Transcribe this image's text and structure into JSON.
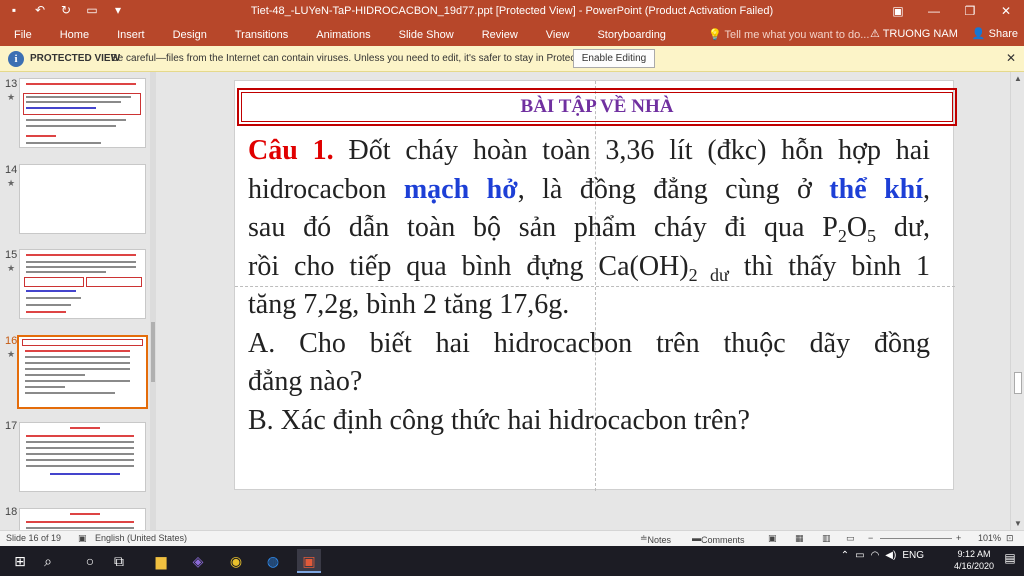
{
  "window": {
    "title": "Tiet-48_-LUYeN-TaP-HIDROCACBON_19d77.ppt [Protected View] - PowerPoint (Product Activation Failed)"
  },
  "ribbon": {
    "tabs": [
      "File",
      "Home",
      "Insert",
      "Design",
      "Transitions",
      "Animations",
      "Slide Show",
      "Review",
      "View",
      "Storyboarding"
    ],
    "tell_me": "Tell me what you want to do...",
    "user": "TRUONG NAM",
    "share": "Share"
  },
  "protected_view": {
    "label": "PROTECTED VIEW",
    "message": "Be careful—files from the Internet can contain viruses. Unless you need to edit, it's safer to stay in Protected View.",
    "button": "Enable Editing"
  },
  "thumbnails": [
    {
      "num": "13",
      "star": "★"
    },
    {
      "num": "14",
      "star": "★"
    },
    {
      "num": "15",
      "star": "★"
    },
    {
      "num": "16",
      "star": "★"
    },
    {
      "num": "17",
      "star": ""
    },
    {
      "num": "18",
      "star": ""
    }
  ],
  "slide": {
    "title": "BÀI TẬP VỀ NHÀ",
    "question_label": "Câu 1.",
    "line1": "Đốt cháy hoàn toàn 3,36 lít (đkc) hỗn hợp hai",
    "line2a": "hidrocacbon",
    "line2b": "mạch hở",
    "line2c": ", là đồng đẳng cùng ở",
    "line2d": "thể khí",
    "line2e": ",",
    "line3a": "sau đó dẫn toàn bộ sản phẩm cháy đi qua P",
    "line3b": "2",
    "line3c": "O",
    "line3d": "5",
    "line3e": " dư,",
    "line4a": "rồi cho tiếp qua bình đựng Ca(OH)",
    "line4b": "2 dư",
    "line4c": " thì thấy bình 1",
    "line5": "tăng 7,2g, bình 2 tăng 17,6g.",
    "line6": "A. Cho biết hai hidrocacbon trên thuộc dãy đồng",
    "line7": "đẳng nào?",
    "line8": "B. Xác định công thức hai hidrocacbon trên?"
  },
  "status": {
    "slide_of": "Slide 16 of 19",
    "language": "English (United States)",
    "notes": "Notes",
    "comments": "Comments",
    "zoom": "101%"
  },
  "taskbar": {
    "language": "ENG",
    "time": "9:12 AM",
    "date": "4/16/2020"
  }
}
